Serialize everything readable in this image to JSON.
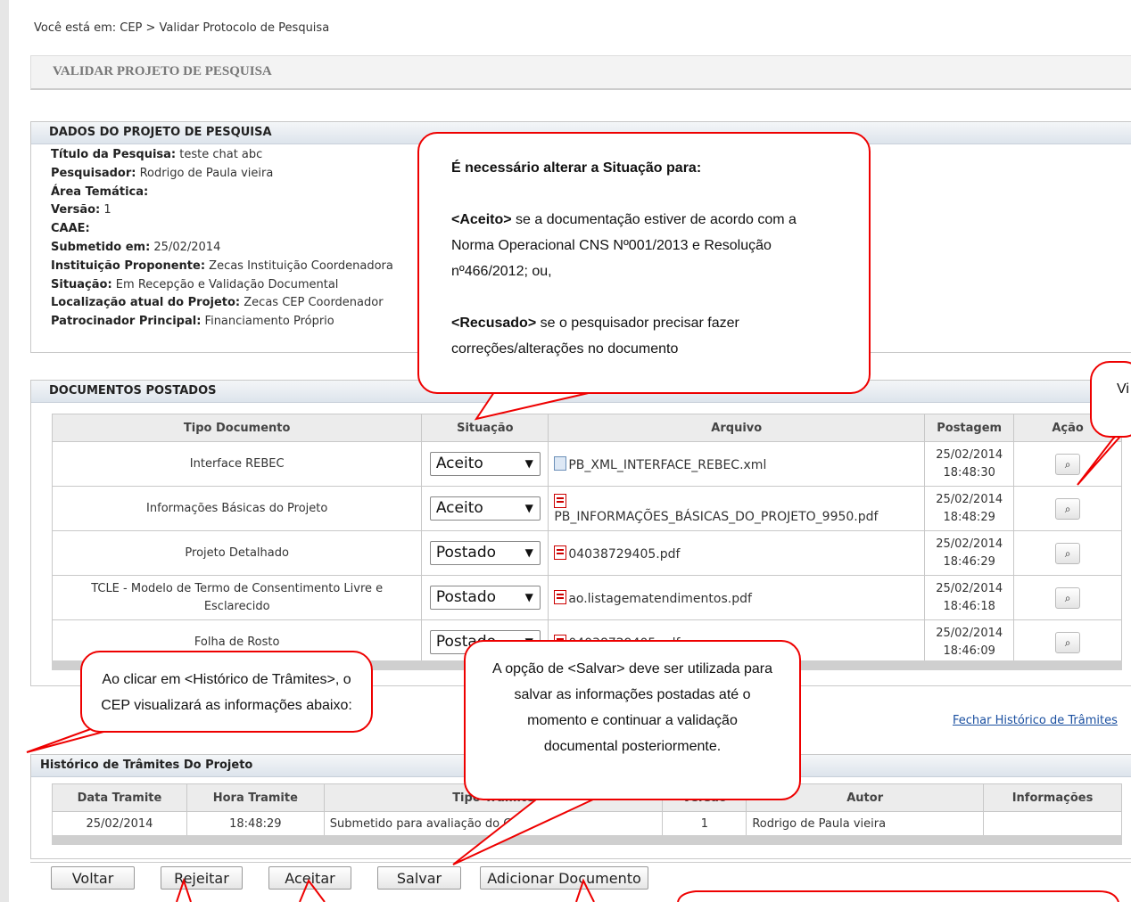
{
  "breadcrumb": "Você está em: CEP > Validar Protocolo de Pesquisa",
  "page_title": "VALIDAR PROJETO DE PESQUISA",
  "project": {
    "header": "DADOS DO PROJETO DE PESQUISA",
    "fields": [
      {
        "label": "Título da Pesquisa:",
        "value": " teste chat abc"
      },
      {
        "label": "Pesquisador:",
        "value": " Rodrigo de Paula vieira"
      },
      {
        "label": "Área Temática:",
        "value": ""
      },
      {
        "label": "Versão:",
        "value": " 1"
      },
      {
        "label": "CAAE:",
        "value": ""
      },
      {
        "label": "Submetido em:",
        "value": " 25/02/2014"
      },
      {
        "label": "Instituição Proponente:",
        "value": " Zecas Instituição Coordenadora"
      },
      {
        "label": "Situação:",
        "value": " Em Recepção e Validação Documental"
      },
      {
        "label": "Localização atual do Projeto:",
        "value": " Zecas CEP Coordenador"
      },
      {
        "label": "Patrocinador Principal:",
        "value": " Financiamento Próprio"
      }
    ]
  },
  "documents": {
    "header": "DOCUMENTOS POSTADOS",
    "columns": [
      "Tipo Documento",
      "Situação",
      "Arquivo",
      "Postagem",
      "Ação"
    ],
    "rows": [
      {
        "tipo": "Interface REBEC",
        "situacao": "Aceito",
        "arquivo": "PB_XML_INTERFACE_REBEC.xml",
        "icon": "xml-file-icon",
        "data": "25/02/2014",
        "hora": "18:48:30"
      },
      {
        "tipo": "Informações Básicas do Projeto",
        "situacao": "Aceito",
        "arquivo": "PB_INFORMAÇÕES_BÁSICAS_DO_PROJETO_9950.pdf",
        "icon": "pdf-file-icon",
        "data": "25/02/2014",
        "hora": "18:48:29"
      },
      {
        "tipo": "Projeto Detalhado",
        "situacao": "Postado",
        "arquivo": "04038729405.pdf",
        "icon": "pdf-file-icon",
        "data": "25/02/2014",
        "hora": "18:46:29"
      },
      {
        "tipo": "TCLE - Modelo de Termo de Consentimento Livre e Esclarecido",
        "situacao": "Postado",
        "arquivo": "ao.listagematendimentos.pdf",
        "icon": "pdf-file-icon",
        "data": "25/02/2014",
        "hora": "18:46:18"
      },
      {
        "tipo": "Folha de Rosto",
        "situacao": "Postado",
        "arquivo": "04038729405.pdf",
        "icon": "pdf-file-icon",
        "data": "25/02/2014",
        "hora": "18:46:09"
      }
    ]
  },
  "history": {
    "toggle_link": "Fechar Histórico de Trâmites",
    "header": "Histórico de Trâmites Do Projeto",
    "columns": [
      "Data Tramite",
      "Hora Tramite",
      "Tipo Trâmite",
      "Versão",
      "Autor",
      "Informações"
    ],
    "rows": [
      {
        "data": "25/02/2014",
        "hora": "18:48:29",
        "tipo": "Submetido para avaliação do CEP",
        "versao": "1",
        "autor": "Rodrigo de Paula vieira",
        "info": ""
      }
    ]
  },
  "buttons": {
    "voltar": "Voltar",
    "rejeitar": "Rejeitar",
    "aceitar": "Aceitar",
    "salvar": "Salvar",
    "adicionar": "Adicionar Documento"
  },
  "callouts": {
    "situacao_title": "É necessário alterar a Situação para:",
    "aceito_tag": "<Aceito>",
    "aceito_text": " se a documentação estiver de acordo com a Norma Operacional CNS Nº001/2013 e Resolução nº466/2012; ou,",
    "recusado_tag": "<Recusado>",
    "recusado_text": " se o pesquisador precisar fazer correções/alterações no documento",
    "historico": "Ao clicar em <Histórico de Trâmites>, o CEP visualizará as informações abaixo:",
    "salvar": "A opção de <Salvar> deve ser utilizada para salvar as informações postadas até o momento e continuar a validação documental posteriormente.",
    "visualizar": "Vi d"
  },
  "colors": {
    "callout_border": "#e00000",
    "panel_header": "#dde4ec",
    "link": "#1a4fa0"
  }
}
